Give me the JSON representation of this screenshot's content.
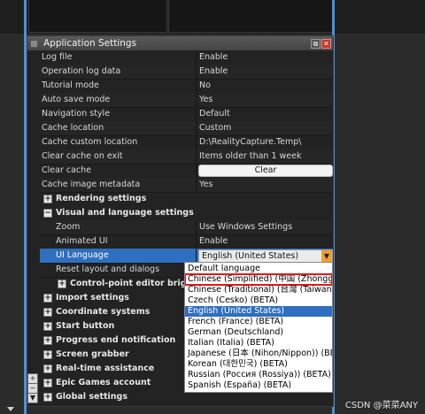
{
  "panel": {
    "title": "Application Settings",
    "restore_symbol": "⧉",
    "close_symbol": "✕"
  },
  "rows": [
    {
      "name": "Log file",
      "value": "Enable"
    },
    {
      "name": "Operation log data",
      "value": "Enable"
    },
    {
      "name": "Tutorial mode",
      "value": "No"
    },
    {
      "name": "Auto save mode",
      "value": "Yes"
    },
    {
      "name": "Navigation style",
      "value": "Default"
    },
    {
      "name": "Cache location",
      "value": "Custom"
    },
    {
      "name": "Cache custom location",
      "value": "D:\\RealityCapture.Temp\\"
    },
    {
      "name": "Clear cache on exit",
      "value": "Items older than 1 week"
    },
    {
      "name": "Clear cache",
      "value": "Clear"
    },
    {
      "name": "Cache image metadata",
      "value": "Yes"
    }
  ],
  "groups": {
    "rendering": "Rendering settings",
    "visual": "Visual and language settings",
    "control_point": "Control-point editor brigh",
    "import": "Import settings",
    "coordinate": "Coordinate systems",
    "start": "Start button",
    "progress": "Progress end notification",
    "screen": "Screen grabber",
    "realtime": "Real-time assistance",
    "epic": "Epic Games account",
    "global": "Global settings"
  },
  "visual_rows": {
    "zoom": {
      "name": "Zoom",
      "value": "Use Windows Settings"
    },
    "animated": {
      "name": "Animated UI",
      "value": "Enable"
    },
    "language": {
      "name": "UI Language",
      "value": "English (United States)"
    },
    "reset": {
      "name": "Reset layout and dialogs"
    }
  },
  "dropdown": {
    "options": [
      "Default language",
      "Chinese (Simplified) (中国 (Zhōnggu",
      "Chinese (Traditional) (台灣 (Taiwan)",
      "Czech (Česko) (BETA)",
      "English (United States)",
      "French (France) (BETA)",
      "German (Deutschland)",
      "Italian (Italia) (BETA)",
      "Japanese (日本 (Nihon/Nippon)) (BE",
      "Korean (대한민국) (BETA)",
      "Russian (Россия (Rossiya)) (BETA)",
      "Spanish (España) (BETA)"
    ],
    "selected": "English (United States)",
    "boxed": "Chinese (Simplified) (中国 (Zhōnggu"
  },
  "expand_symbol": "+",
  "collapse_symbol": "−",
  "dropdown_arrow": "▼",
  "watermark": "CSDN @菜菜ANY",
  "colors": {
    "accent": "#2f6fbf",
    "highlight_box": "#e01818",
    "dropdown_arrow_bg": "#f0a030"
  }
}
